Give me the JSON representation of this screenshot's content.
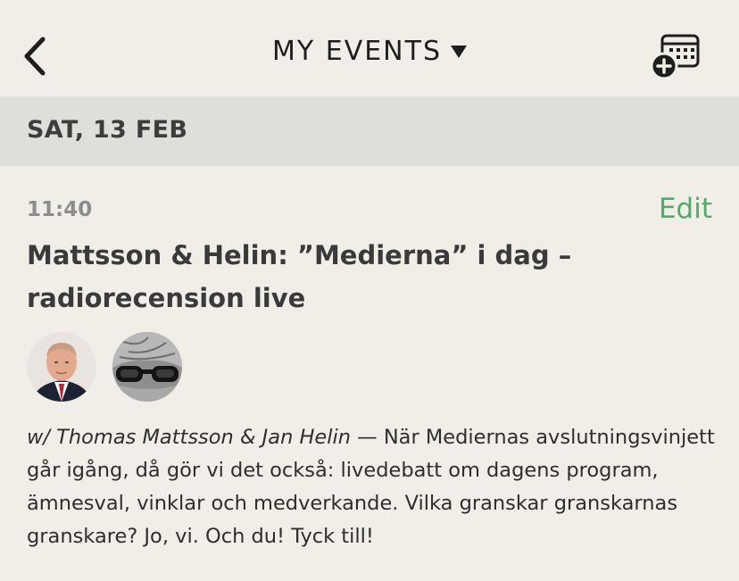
{
  "header": {
    "title": "MY EVENTS",
    "back_icon": "chevron-left-icon",
    "dropdown_icon": "caret-down-icon",
    "add_calendar_icon": "calendar-add-icon"
  },
  "date_section": {
    "label": "SAT, 13 FEB"
  },
  "event": {
    "time": "11:40",
    "edit_label": "Edit",
    "title": "Mattsson & Helin: ”Medierna” i dag – radiorecension live",
    "hosts_label": "w/ Thomas Mattsson & Jan Helin",
    "separator": " — ",
    "description": "När Mediernas avslutningsvinjett går igång, då gör vi det också: livedebatt om dagens program, ämnesval, vinklar och medverkande. Vilka granskar granskarnas granskare? Jo, vi. Och du! Tyck till!"
  },
  "colors": {
    "background": "#f1eee8",
    "date_header_bg": "#dfdfda",
    "accent_green": "#55a86b",
    "time_gray": "#8d8d8d"
  }
}
